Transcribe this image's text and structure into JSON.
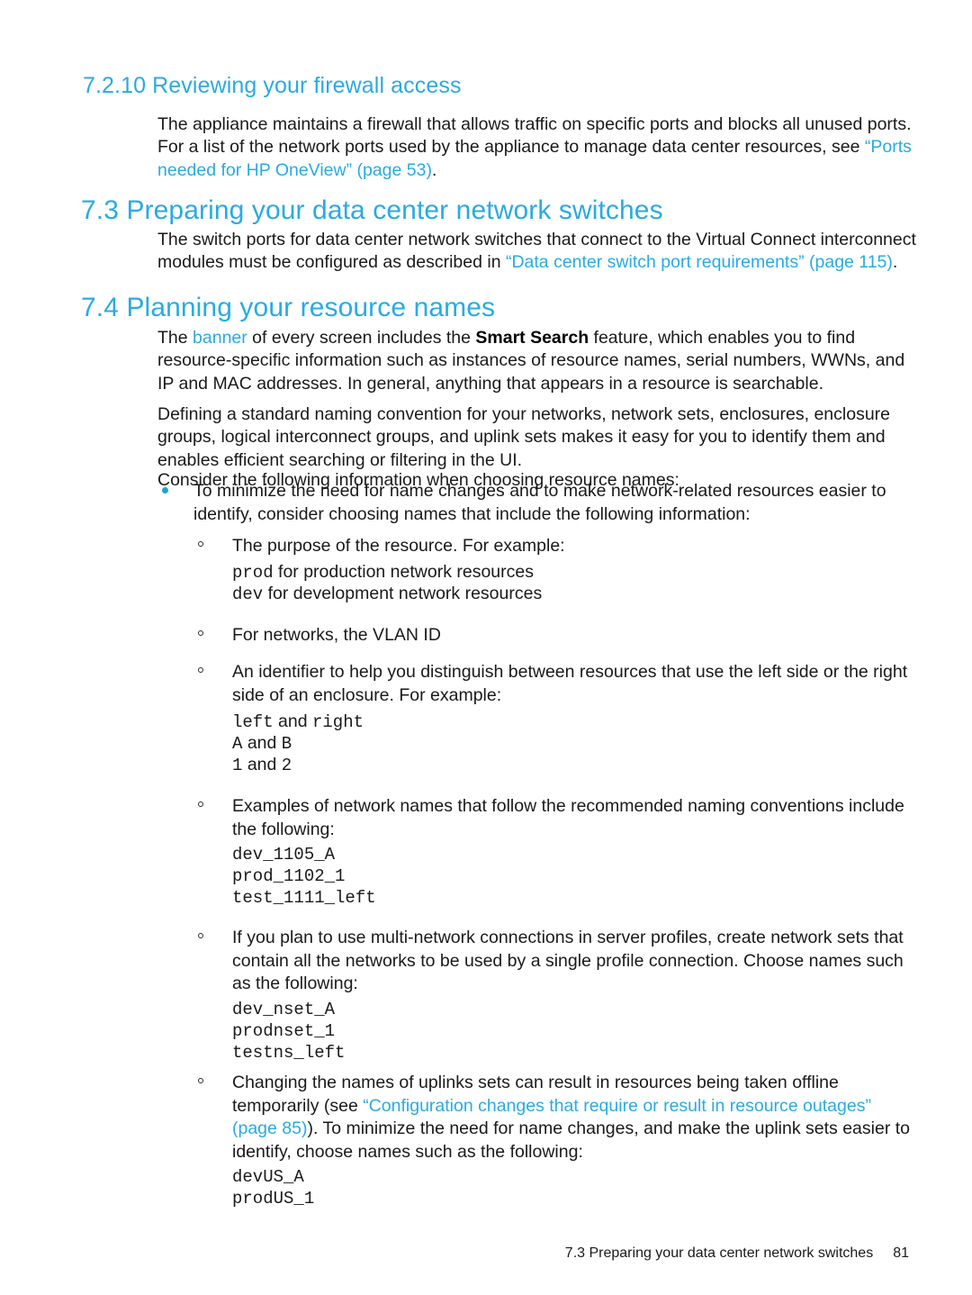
{
  "colors": {
    "heading_blue": "#29ABE2",
    "link_blue": "#29ABE2",
    "bullet_blue": "#1DA1DC",
    "body_text": "#1a1a1a",
    "page_background": "#ffffff"
  },
  "sections": {
    "s7_2_10": {
      "heading": "7.2.10 Reviewing your firewall access",
      "para1_a": "The appliance maintains a firewall that allows traffic on specific ports and blocks all unused ports. For a list of the network ports used by the appliance to manage data center resources, see ",
      "para1_link": "“Ports needed for HP OneView” (page 53)",
      "para1_b": "."
    },
    "s7_3": {
      "heading": "7.3 Preparing your data center network switches",
      "para1_a": "The switch ports for data center network switches that connect to the Virtual Connect interconnect modules must be configured as described in ",
      "para1_link": "“Data center switch port requirements” (page 115)",
      "para1_b": "."
    },
    "s7_4": {
      "heading": "7.4 Planning your resource names",
      "para1_a": "The ",
      "para1_link": "banner",
      "para1_b": " of every screen includes the ",
      "para1_bold": "Smart Search",
      "para1_c": " feature, which enables you to find resource-specific information such as instances of resource names, serial numbers, WWNs, and IP and MAC addresses. In general, anything that appears in a resource is searchable.",
      "para2": "Defining a standard naming convention for your networks, network sets, enclosures, enclosure groups, logical interconnect groups, and uplink sets makes it easy for you to identify them and enables efficient searching or filtering in the UI.",
      "para3": "Consider the following information when choosing resource names:",
      "bullet1": "To minimize the need for name changes and to make network-related resources easier to identify, consider choosing names that include the following information:",
      "sub1": {
        "text": "The purpose of the resource. For example:",
        "code_line1_term": "prod",
        "code_line1_rest": " for production network resources",
        "code_line2_term": "dev",
        "code_line2_rest": " for development network resources"
      },
      "sub2": {
        "text": "For networks, the VLAN ID"
      },
      "sub3": {
        "text": "An identifier to help you distinguish between resources that use the left side or the right side of an enclosure. For example:",
        "code_line1_a": "left",
        "code_line1_mid": " and ",
        "code_line1_b": "right",
        "code_line2_a": "A",
        "code_line2_mid": " and ",
        "code_line2_b": "B",
        "code_line3_a": "1",
        "code_line3_mid": " and ",
        "code_line3_b": "2"
      },
      "sub4": {
        "text": "Examples of network names that follow the recommended naming conventions include the following:",
        "code": [
          "dev_1105_A",
          "prod_1102_1",
          "test_1111_left"
        ]
      },
      "sub5": {
        "text": "If you plan to use multi-network connections in server profiles, create network sets that contain all the networks to be used by a single profile connection. Choose names such as the following:",
        "code": [
          "dev_nset_A",
          "prodnset_1",
          "testns_left"
        ]
      },
      "sub6": {
        "text_a": "Changing the names of uplinks sets can result in resources being taken offline temporarily (see ",
        "text_link": "“Configuration changes that require or result in resource outages” (page 85)",
        "text_b": "). To minimize the need for name changes, and make the uplink sets easier to identify, choose names such as the following:",
        "code": [
          "devUS_A",
          "prodUS_1"
        ]
      }
    }
  },
  "footer": {
    "title": "7.3 Preparing your data center network switches",
    "page_number": "81"
  }
}
